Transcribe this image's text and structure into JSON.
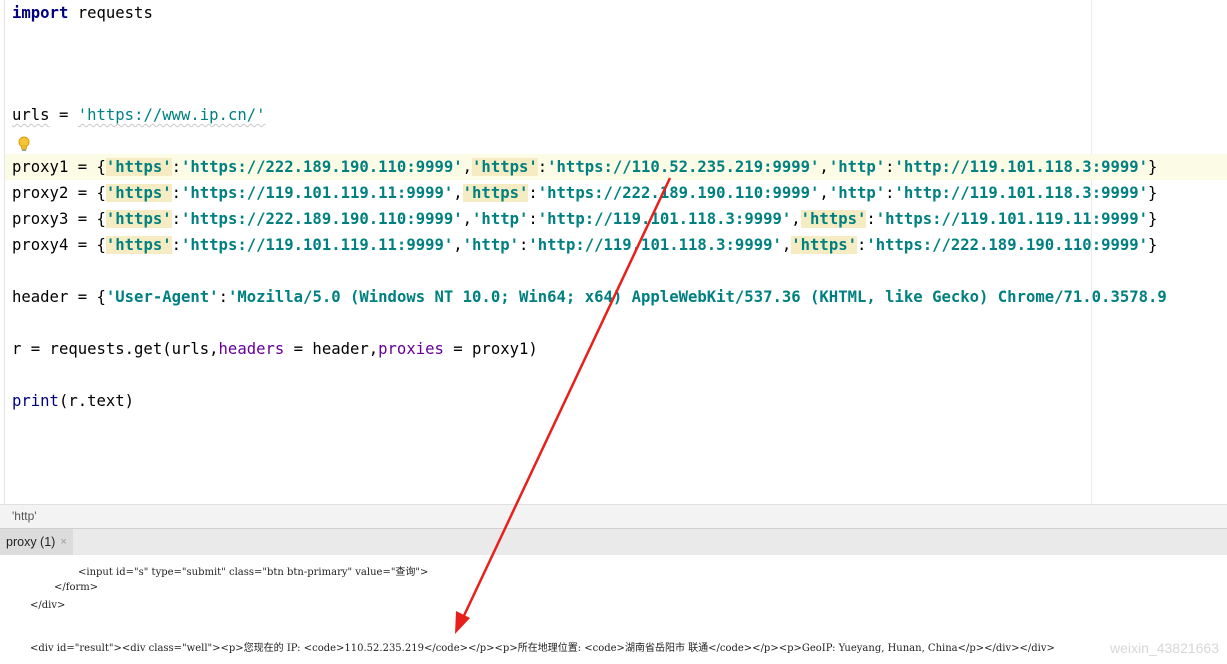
{
  "editor": {
    "line1": {
      "kw": "import",
      "rest": " requests"
    },
    "urls": {
      "name": "urls",
      "eq": " = ",
      "value": "'https://www.ip.cn/'"
    },
    "proxies": [
      {
        "prefix": "proxy1 = {",
        "parts": [
          {
            "k": "'https'",
            "v": "'https://222.189.190.110:9999'",
            "hl": true
          },
          {
            "k": "'https'",
            "v": "'https://110.52.235.219:9999'",
            "hl": true
          },
          {
            "k": "'http'",
            "v": "'http://119.101.118.3:9999'",
            "hl": false
          }
        ],
        "suffix": "}"
      },
      {
        "prefix": "proxy2 = {",
        "parts": [
          {
            "k": "'https'",
            "v": "'https://119.101.119.11:9999'",
            "hl": true
          },
          {
            "k": "'https'",
            "v": "'https://222.189.190.110:9999'",
            "hl": true
          },
          {
            "k": "'http'",
            "v": "'http://119.101.118.3:9999'",
            "hl": false
          }
        ],
        "suffix": "}"
      },
      {
        "prefix": "proxy3 = {",
        "parts": [
          {
            "k": "'https'",
            "v": "'https://222.189.190.110:9999'",
            "hl": true
          },
          {
            "k": "'http'",
            "v": "'http://119.101.118.3:9999'",
            "hl": false
          },
          {
            "k": "'https'",
            "v": "'https://119.101.119.11:9999'",
            "hl": true
          }
        ],
        "suffix": "}"
      },
      {
        "prefix": "proxy4 = {",
        "parts": [
          {
            "k": "'https'",
            "v": "'https://119.101.119.11:9999'",
            "hl": true
          },
          {
            "k": "'http'",
            "v": "'http://119.101.118.3:9999'",
            "hl": false
          },
          {
            "k": "'https'",
            "v": "'https://222.189.190.110:9999'",
            "hl": true
          }
        ],
        "suffix": "}"
      }
    ],
    "header": {
      "prefix": "header = {",
      "key": "'User-Agent'",
      "colon": ":",
      "value": "'Mozilla/5.0 (Windows NT 10.0; Win64; x64) AppleWebKit/537.36 (KHTML, like Gecko) Chrome/71.0.3578.9"
    },
    "request": {
      "a": "r = requests.get(urls,",
      "kw1": "headers",
      "b": " = header,",
      "kw2": "proxies",
      "c": " = proxy1)"
    },
    "print": {
      "fn": "print",
      "rest": "(r.text)"
    }
  },
  "breadcrumb": "'http'",
  "run_tab": {
    "label": "proxy (1)",
    "close": "×"
  },
  "console": {
    "lines": [
      "<input id=\"s\" type=\"submit\" class=\"btn btn-primary\" value=\"查询\">",
      "</form>",
      "</div>",
      "<div id=\"result\"><div class=\"well\"><p>您现在的 IP: <code>110.52.235.219</code></p><p>所在地理位置: <code>湖南省岳阳市 联通</code></p><p>GeoIP: Yueyang, Hunan, China</p></div></div>"
    ],
    "watermark": "weixin_43821663"
  },
  "colors": {
    "keyword": "#000080",
    "string": "#008080",
    "kwarg": "#660099",
    "highlight": "#f5ecc3",
    "arrow": "#e8201b"
  }
}
